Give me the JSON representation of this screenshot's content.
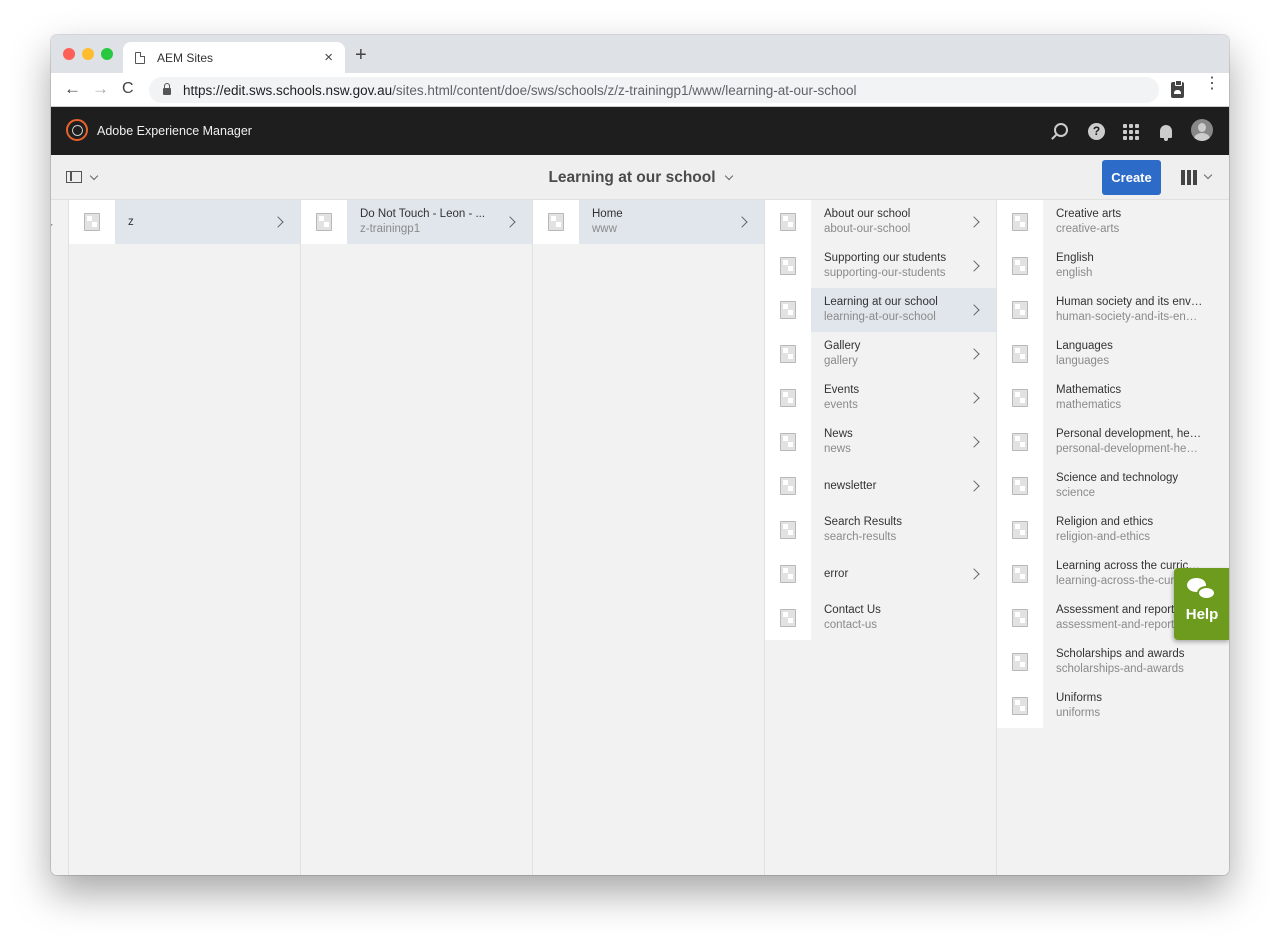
{
  "browser": {
    "tab_title": "AEM Sites",
    "close_glyph": "×",
    "new_tab_glyph": "+",
    "url_host": "https://edit.sws.schools.nsw.gov.au",
    "url_path": "/sites.html/content/doe/sws/schools/z/z-trainingp1/www/learning-at-our-school",
    "back_glyph": "←",
    "forward_glyph": "→",
    "reload_glyph": "C",
    "menu_glyph": "⋮"
  },
  "header": {
    "app_title": "Adobe Experience Manager",
    "help_glyph": "?"
  },
  "actionbar": {
    "page_title": "Learning at our school",
    "create_label": "Create"
  },
  "columns": [
    {
      "rows": [
        {
          "title": "z",
          "name": "",
          "has_children": true,
          "active": true
        }
      ]
    },
    {
      "rows": [
        {
          "title": "Do Not Touch - Leon - ...",
          "name": "z-trainingp1",
          "has_children": true,
          "active": true
        }
      ]
    },
    {
      "rows": [
        {
          "title": "Home",
          "name": "www",
          "has_children": true,
          "active": true
        }
      ]
    },
    {
      "rows": [
        {
          "title": "About our school",
          "name": "about-our-school",
          "has_children": true,
          "active": false
        },
        {
          "title": "Supporting our students",
          "name": "supporting-our-students",
          "has_children": true,
          "active": false
        },
        {
          "title": "Learning at our school",
          "name": "learning-at-our-school",
          "has_children": true,
          "active": true
        },
        {
          "title": "Gallery",
          "name": "gallery",
          "has_children": true,
          "active": false
        },
        {
          "title": "Events",
          "name": "events",
          "has_children": true,
          "active": false
        },
        {
          "title": "News",
          "name": "news",
          "has_children": true,
          "active": false
        },
        {
          "title": "newsletter",
          "name": "",
          "has_children": true,
          "active": false
        },
        {
          "title": "Search Results",
          "name": "search-results",
          "has_children": false,
          "active": false
        },
        {
          "title": "error",
          "name": "",
          "has_children": true,
          "active": false
        },
        {
          "title": "Contact Us",
          "name": "contact-us",
          "has_children": false,
          "active": false
        }
      ]
    },
    {
      "rows": [
        {
          "title": "Creative arts",
          "name": "creative-arts",
          "has_children": false,
          "active": false
        },
        {
          "title": "English",
          "name": "english",
          "has_children": false,
          "active": false
        },
        {
          "title": "Human society and its environ...",
          "name": "human-society-and-its-enviro...",
          "has_children": false,
          "active": false
        },
        {
          "title": "Languages",
          "name": "languages",
          "has_children": false,
          "active": false
        },
        {
          "title": "Mathematics",
          "name": "mathematics",
          "has_children": false,
          "active": false
        },
        {
          "title": "Personal development, health ...",
          "name": "personal-development-health...",
          "has_children": false,
          "active": false
        },
        {
          "title": "Science and technology",
          "name": "science",
          "has_children": false,
          "active": false
        },
        {
          "title": "Religion and ethics",
          "name": "religion-and-ethics",
          "has_children": false,
          "active": false
        },
        {
          "title": "Learning across the curriculum",
          "name": "learning-across-the-curriculum",
          "has_children": false,
          "active": false
        },
        {
          "title": "Assessment and reporting",
          "name": "assessment-and-reporting",
          "has_children": false,
          "active": false
        },
        {
          "title": "Scholarships and awards",
          "name": "scholarships-and-awards",
          "has_children": false,
          "active": false
        },
        {
          "title": "Uniforms",
          "name": "uniforms",
          "has_children": false,
          "active": false
        }
      ]
    }
  ],
  "help_widget": {
    "label": "Help",
    "color": "#6d9b1e"
  },
  "colors": {
    "create_button": "#2d6bc9",
    "header_bg": "#1e1e1e",
    "logo_accent": "#e8632c",
    "active_row": "#e1e6ed"
  }
}
